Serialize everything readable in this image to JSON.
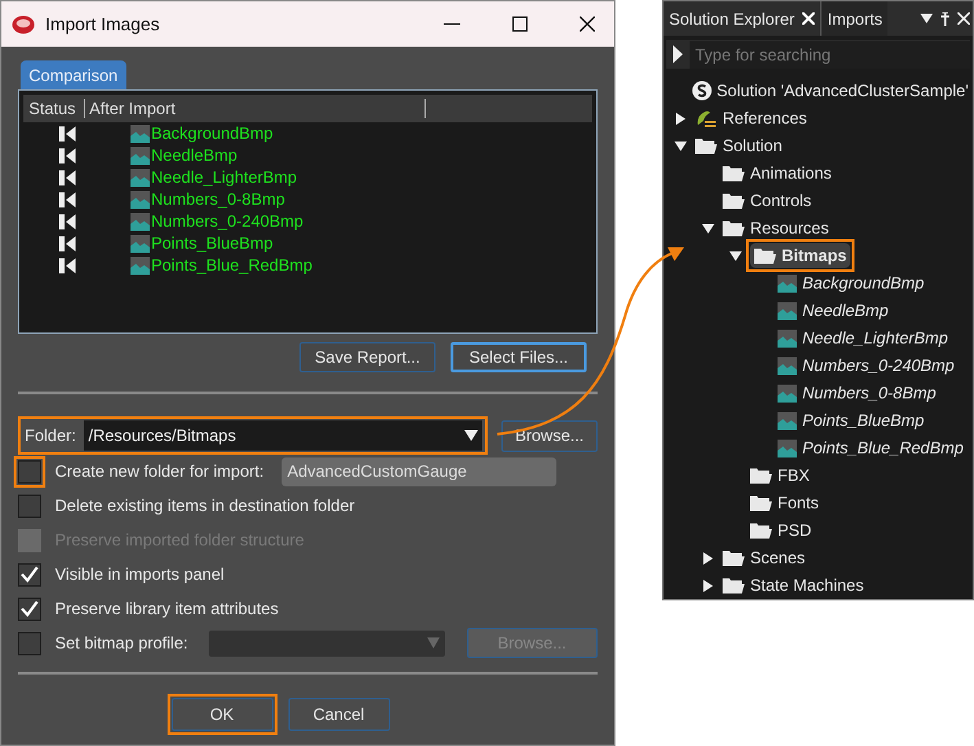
{
  "window": {
    "title": "Import Images"
  },
  "tabs": [
    {
      "label": "Comparison",
      "selected": true
    }
  ],
  "table": {
    "columns": [
      "Status",
      "After Import"
    ],
    "rows": [
      {
        "after_import": "BackgroundBmp"
      },
      {
        "after_import": "NeedleBmp"
      },
      {
        "after_import": "Needle_LighterBmp"
      },
      {
        "after_import": "Numbers_0-8Bmp"
      },
      {
        "after_import": "Numbers_0-240Bmp"
      },
      {
        "after_import": "Points_BlueBmp"
      },
      {
        "after_import": "Points_Blue_RedBmp"
      }
    ]
  },
  "report_buttons": [
    {
      "label": "Save Report...",
      "focused": false
    },
    {
      "label": "Select Files...",
      "focused": true
    }
  ],
  "folder": {
    "label": "Folder:",
    "value": "/Resources/Bitmaps",
    "browse": "Browse...",
    "highlighted": true
  },
  "options": [
    {
      "kind": "text",
      "label": "Create new folder for import:",
      "checked": false,
      "disabled": false,
      "highlighted": true,
      "value": "AdvancedCustomGauge"
    },
    {
      "kind": "plain",
      "label": "Delete existing items in destination folder",
      "checked": false,
      "disabled": false,
      "highlighted": false
    },
    {
      "kind": "plain",
      "label": "Preserve imported folder structure",
      "checked": false,
      "disabled": true,
      "highlighted": false
    },
    {
      "kind": "plain",
      "label": "Visible in imports panel",
      "checked": true,
      "disabled": false,
      "highlighted": false
    },
    {
      "kind": "plain",
      "label": "Preserve library item attributes",
      "checked": true,
      "disabled": false,
      "highlighted": false
    },
    {
      "kind": "profile",
      "label": "Set bitmap profile:",
      "checked": false,
      "disabled": false,
      "highlighted": false,
      "browse": "Browse..."
    }
  ],
  "buttons": [
    {
      "label": "OK",
      "highlighted": true
    },
    {
      "label": "Cancel",
      "highlighted": false
    }
  ],
  "explorer": {
    "tabs": [
      {
        "label": "Solution Explorer",
        "selected": true
      },
      {
        "label": "Imports",
        "selected": false
      }
    ],
    "search": {
      "placeholder": "Type for searching"
    },
    "tree": [
      {
        "kind": "solution",
        "label": "Solution 'AdvancedClusterSample'",
        "selected": false,
        "highlighted": false
      },
      {
        "kind": "reference",
        "label": "References",
        "expanded": false,
        "selected": false,
        "highlighted": false
      },
      {
        "kind": "folder",
        "label": "Solution",
        "expanded": true,
        "selected": false,
        "highlighted": false,
        "children": [
          {
            "kind": "folder",
            "label": "Animations",
            "selected": false,
            "highlighted": false
          },
          {
            "kind": "folder",
            "label": "Controls",
            "selected": false,
            "highlighted": false
          },
          {
            "kind": "folder",
            "label": "Resources",
            "expanded": true,
            "selected": false,
            "highlighted": false,
            "children": [
              {
                "kind": "folder",
                "label": "Bitmaps",
                "expanded": true,
                "selected": true,
                "highlighted": true,
                "children": [
                  {
                    "kind": "bitmap",
                    "label": "BackgroundBmp",
                    "selected": false,
                    "highlighted": false
                  },
                  {
                    "kind": "bitmap",
                    "label": "NeedleBmp",
                    "selected": false,
                    "highlighted": false
                  },
                  {
                    "kind": "bitmap",
                    "label": "Needle_LighterBmp",
                    "selected": false,
                    "highlighted": false
                  },
                  {
                    "kind": "bitmap",
                    "label": "Numbers_0-240Bmp",
                    "selected": false,
                    "highlighted": false
                  },
                  {
                    "kind": "bitmap",
                    "label": "Numbers_0-8Bmp",
                    "selected": false,
                    "highlighted": false
                  },
                  {
                    "kind": "bitmap",
                    "label": "Points_BlueBmp",
                    "selected": false,
                    "highlighted": false
                  },
                  {
                    "kind": "bitmap",
                    "label": "Points_Blue_RedBmp",
                    "selected": false,
                    "highlighted": false
                  }
                ]
              },
              {
                "kind": "folder",
                "label": "FBX",
                "selected": false,
                "highlighted": false
              },
              {
                "kind": "folder",
                "label": "Fonts",
                "selected": false,
                "highlighted": false
              },
              {
                "kind": "folder",
                "label": "PSD",
                "selected": false,
                "highlighted": false
              }
            ]
          },
          {
            "kind": "folder",
            "label": "Scenes",
            "expanded": false,
            "selected": false,
            "highlighted": false
          },
          {
            "kind": "folder",
            "label": "State Machines",
            "expanded": false,
            "selected": false,
            "highlighted": false
          }
        ]
      }
    ]
  }
}
